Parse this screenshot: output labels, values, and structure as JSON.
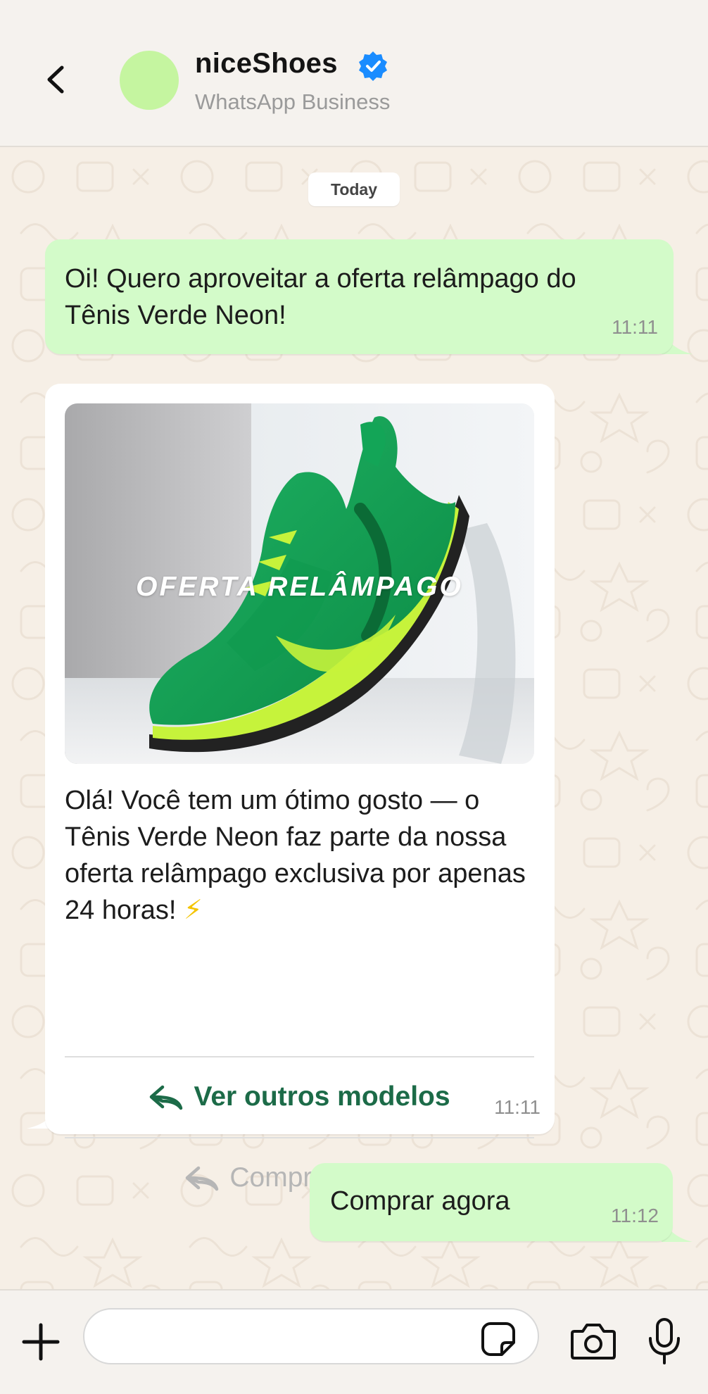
{
  "header": {
    "contact_name": "niceShoes",
    "contact_subtitle": "WhatsApp Business",
    "verified_color": "#1a8cff",
    "avatar_color": "#c5f5a0"
  },
  "chat": {
    "date_chip": "Today",
    "messages": [
      {
        "direction": "outgoing",
        "text": "Oi! Quero aproveitar a oferta relâmpago do Tênis Verde Neon!",
        "time": "11:11"
      },
      {
        "direction": "incoming",
        "image_banner": "OFERTA RELÂMPAGO",
        "image_subject": "green sneaker",
        "text": "Olá! Você tem um ótimo gosto — o Tênis Verde Neon faz parte da nossa oferta relâmpago exclusiva por apenas 24 horas!",
        "emoji": "⚡",
        "actions": [
          {
            "label": "Ver outros modelos",
            "icon": "reply-icon",
            "enabled": true
          },
          {
            "label": "Comprar agora",
            "icon": "reply-icon",
            "enabled": false
          }
        ],
        "time": "11:11"
      },
      {
        "direction": "outgoing",
        "text": "Comprar agora",
        "time": "11:12"
      }
    ]
  },
  "composer": {
    "input_value": "",
    "icons": [
      "plus-icon",
      "sticker-icon",
      "camera-icon",
      "mic-icon"
    ]
  },
  "colors": {
    "outgoing_bubble": "#d3fbc9",
    "incoming_bubble": "#ffffff",
    "action_primary": "#1c6b48",
    "action_disabled": "#b6b6b6",
    "chat_background": "#f6efe6"
  }
}
